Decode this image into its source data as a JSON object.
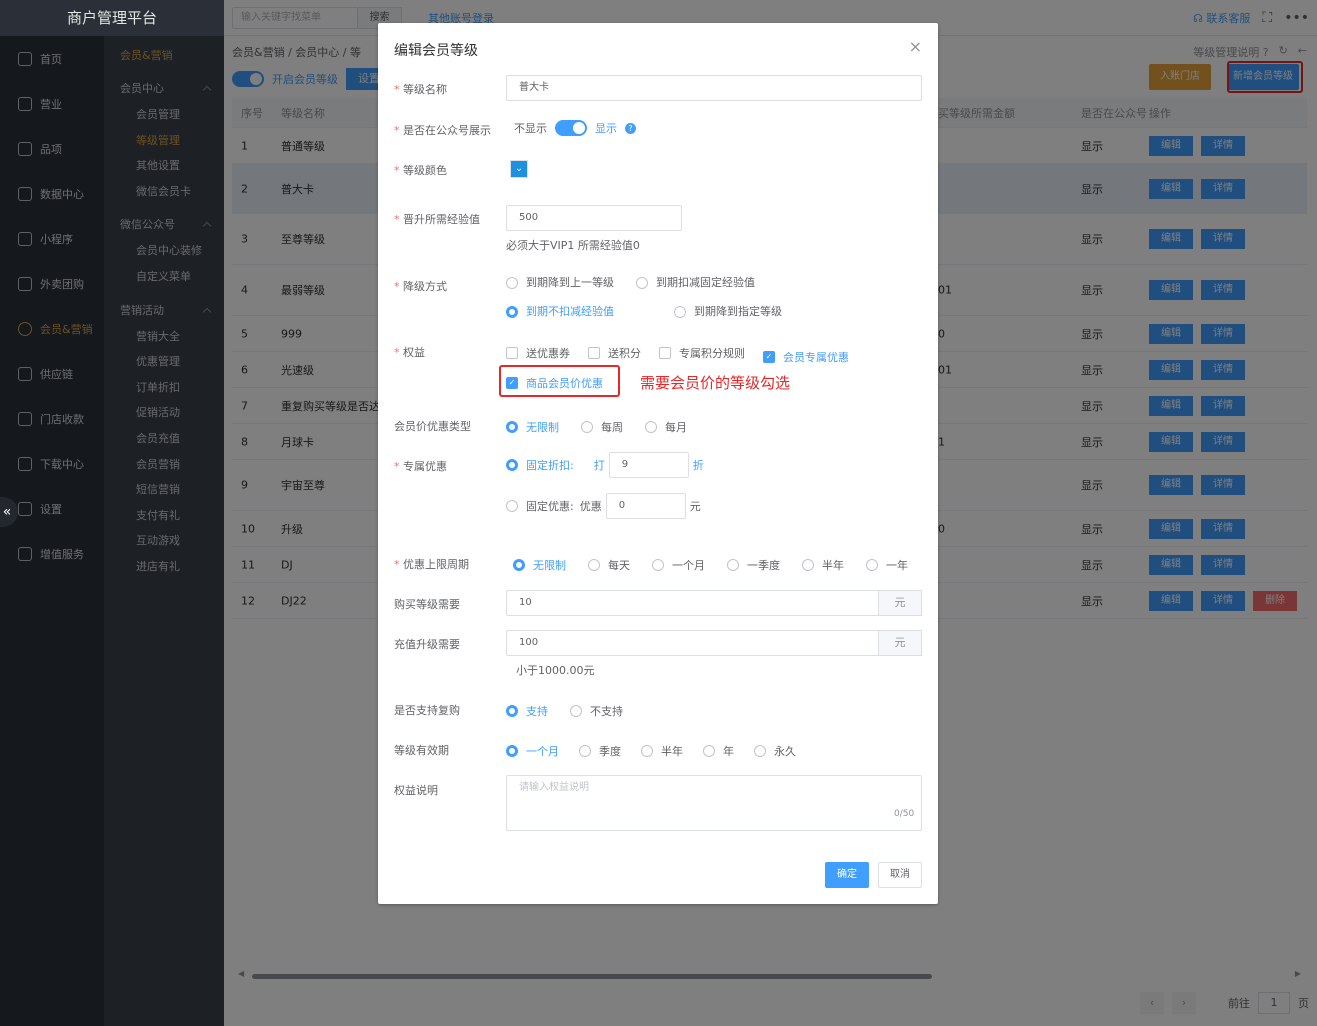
{
  "app": {
    "title": "商户管理平台"
  },
  "mainnav": [
    {
      "label": "首页",
      "icon": "home-icon"
    },
    {
      "label": "营业",
      "icon": "calendar-icon"
    },
    {
      "label": "品项",
      "icon": "bag-icon"
    },
    {
      "label": "数据中心",
      "icon": "share-icon"
    },
    {
      "label": "小程序",
      "icon": "phone-icon"
    },
    {
      "label": "外卖团购",
      "icon": "bike-icon"
    },
    {
      "label": "会员&营销",
      "icon": "user-icon",
      "active": true
    },
    {
      "label": "供应链",
      "icon": "truck-icon"
    },
    {
      "label": "门店收款",
      "icon": "database-icon"
    },
    {
      "label": "下载中心",
      "icon": "download-icon"
    },
    {
      "label": "设置",
      "icon": "gear-icon"
    },
    {
      "label": "增值服务",
      "icon": "plus-icon"
    }
  ],
  "subnav": {
    "header": "会员&营销",
    "groups": [
      {
        "label": "会员中心",
        "items": [
          "会员管理",
          "等级管理",
          "其他设置",
          "微信会员卡"
        ]
      },
      {
        "label": "微信公众号",
        "items": [
          "会员中心装修",
          "自定义菜单"
        ]
      },
      {
        "label": "营销活动",
        "items": [
          "营销大全",
          "优惠管理",
          "订单折扣",
          "促销活动",
          "会员充值",
          "会员营销",
          "短信营销",
          "支付有礼",
          "互动游戏",
          "进店有礼"
        ]
      }
    ],
    "active_item": "等级管理"
  },
  "topbar": {
    "search_placeholder": "输入关键字找菜单",
    "search_button": "搜索",
    "other_login": "其他账号登录",
    "contact": "联系客服"
  },
  "page": {
    "breadcrumb": [
      "会员&营销",
      "会员中心",
      "等"
    ],
    "help_text": "等级管理说明",
    "toggle_label": "开启会员等级",
    "set_button": "设置",
    "store_button": "入账门店",
    "new_level_button": "新增会员等级"
  },
  "table": {
    "columns": {
      "index": "序号",
      "name": "等级名称",
      "amount": "买等级所需金额",
      "show": "是否在公众号",
      "ops": "操作"
    },
    "rows": [
      {
        "index": "1",
        "name": "普通等级",
        "amount": "",
        "show": "显示",
        "del": false,
        "h": 36
      },
      {
        "index": "2",
        "name": "普大卡",
        "amount": "",
        "show": "显示",
        "del": false,
        "h": 50,
        "hl": true
      },
      {
        "index": "3",
        "name": "至尊等级",
        "amount": "",
        "show": "显示",
        "del": false,
        "h": 51
      },
      {
        "index": "4",
        "name": "最弱等级",
        "amount": "01",
        "show": "显示",
        "del": false,
        "h": 51
      },
      {
        "index": "5",
        "name": "999",
        "amount": "0",
        "show": "显示",
        "del": false,
        "h": 36
      },
      {
        "index": "6",
        "name": "光速级",
        "amount": "01",
        "show": "显示",
        "del": false,
        "h": 36
      },
      {
        "index": "7",
        "name": "重复购买等级是否达",
        "amount": "",
        "show": "显示",
        "del": false,
        "h": 36
      },
      {
        "index": "8",
        "name": "月球卡",
        "amount": "1",
        "show": "显示",
        "del": false,
        "h": 36
      },
      {
        "index": "9",
        "name": "宇宙至尊",
        "amount": "",
        "show": "显示",
        "del": false,
        "h": 51
      },
      {
        "index": "10",
        "name": "升级",
        "amount": "0",
        "show": "显示",
        "del": false,
        "h": 36
      },
      {
        "index": "11",
        "name": "DJ",
        "amount": "",
        "show": "显示",
        "del": false,
        "h": 36
      },
      {
        "index": "12",
        "name": "DJ22",
        "amount": "",
        "show": "显示",
        "del": true,
        "h": 36
      }
    ],
    "edit_label": "编辑",
    "detail_label": "详情",
    "delete_label": "删除"
  },
  "pager": {
    "goto_label": "前往",
    "page": "1",
    "page_suffix": "页"
  },
  "dialog": {
    "title": "编辑会员等级",
    "close": "×",
    "level_name": {
      "label": "等级名称",
      "value": "普大卡"
    },
    "public_show": {
      "label": "是否在公众号展示",
      "off_text": "不显示",
      "on_text": "显示",
      "enabled": true
    },
    "level_color": {
      "label": "等级颜色",
      "value": "#1f8fe0"
    },
    "exp": {
      "label": "晋升所需经验值",
      "value": "500",
      "hint": "必须大于VIP1 所需经验值0"
    },
    "downgrade": {
      "label": "降级方式",
      "options": [
        "到期降到上一等级",
        "到期扣减固定经验值",
        "到期不扣减经验值",
        "到期降到指定等级"
      ],
      "selected": "到期不扣减经验值"
    },
    "rights": {
      "label": "权益",
      "options": [
        "送优惠券",
        "送积分",
        "专属积分规则",
        "会员专属优惠"
      ],
      "checked": [
        "会员专属优惠"
      ],
      "goods_price": {
        "label": "商品会员价优惠",
        "checked": true
      }
    },
    "annotation": "需要会员价的等级勾选",
    "price_type": {
      "label": "会员价优惠类型",
      "options": [
        "无限制",
        "每周",
        "每月"
      ],
      "selected": "无限制"
    },
    "exclusive": {
      "label": "专属优惠",
      "fixed_discount": "固定折扣:",
      "da": "打",
      "discount_value": "9",
      "zhe": "折",
      "fixed_amount": "固定优惠:",
      "youhui": "优惠",
      "amount_value": "0",
      "yuan": "元",
      "selected": "固定折扣:"
    },
    "limit_period": {
      "label": "优惠上限周期",
      "options": [
        "无限制",
        "每天",
        "一个月",
        "一季度",
        "半年",
        "一年"
      ],
      "selected": "无限制"
    },
    "buy_need": {
      "label": "购买等级需要",
      "value": "10",
      "unit": "元"
    },
    "recharge_need": {
      "label": "充值升级需要",
      "value": "100",
      "unit": "元",
      "hint": "小于1000.00元"
    },
    "rebuy": {
      "label": "是否支持复购",
      "options": [
        "支持",
        "不支持"
      ],
      "selected": "支持"
    },
    "valid": {
      "label": "等级有效期",
      "options": [
        "一个月",
        "季度",
        "半年",
        "年",
        "永久"
      ],
      "selected": "一个月"
    },
    "desc": {
      "label": "权益说明",
      "placeholder": "请输入权益说明",
      "counter": "0/50"
    },
    "ok": "确定",
    "cancel": "取消"
  }
}
